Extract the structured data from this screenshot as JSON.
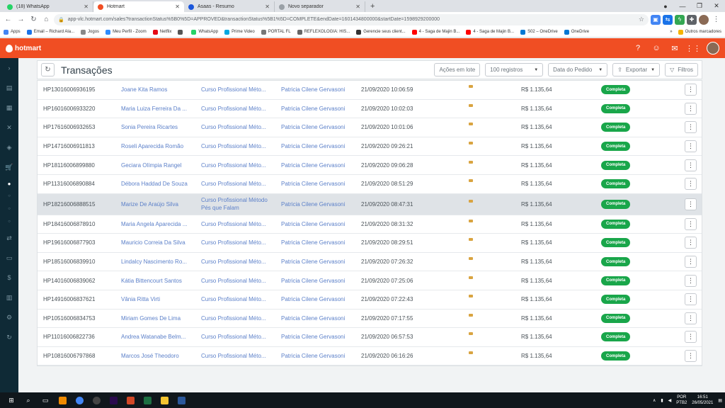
{
  "browser": {
    "tabs": [
      {
        "title": "(18) WhatsApp",
        "color": "#25d366",
        "active": false
      },
      {
        "title": "Hotmart",
        "color": "#f04e23",
        "active": true
      },
      {
        "title": "Asaas - Resumo",
        "color": "#1a56db",
        "active": false
      },
      {
        "title": "Novo separador",
        "color": "#9aa0a6",
        "active": false
      }
    ],
    "new_tab": "+",
    "url": "app-vlc.hotmart.com/sales?transactionStatus%5B0%5D=APPROVED&transactionStatus%5B1%5D=COMPLETE&endDate=1601434800000&startDate=1598929200000",
    "bookmarks": [
      {
        "label": "Apps",
        "color": "#4285f4"
      },
      {
        "label": "Email – Richard Ala...",
        "color": "#1a73e8"
      },
      {
        "label": "Jogos",
        "color": "#888888"
      },
      {
        "label": "Meu Perfil - Zoom",
        "color": "#2d8cff"
      },
      {
        "label": "Netflix",
        "color": "#e50914"
      },
      {
        "label": "",
        "color": "#555555"
      },
      {
        "label": "WhatsApp",
        "color": "#25d366"
      },
      {
        "label": "Prime Video",
        "color": "#00a8e1"
      },
      {
        "label": "PORTAL FL",
        "color": "#777777"
      },
      {
        "label": "REFLEXOLOGIA: HIS...",
        "color": "#666666"
      },
      {
        "label": "Gerencie seus client...",
        "color": "#333333"
      },
      {
        "label": "4 - Saga de Majin B...",
        "color": "#ff0000"
      },
      {
        "label": "4 - Saga de Majin B...",
        "color": "#ff0000"
      },
      {
        "label": "S02 – OneDrive",
        "color": "#0078d4"
      },
      {
        "label": "OneDrive",
        "color": "#0078d4"
      }
    ],
    "bookmarks_more": "»",
    "other_bookmarks": "Outros marcadores"
  },
  "header": {
    "logo": "hotmart",
    "accent": "#f04e23"
  },
  "toolbar": {
    "title": "Transações",
    "batch_actions": "Ações em lote",
    "page_size": "100 registros",
    "sort": "Data do Pedido",
    "export": "Exportar",
    "filters": "Filtros"
  },
  "transactions": [
    {
      "code": "HP13016006936195",
      "buyer": "Joane Kita Ramos",
      "product": "Curso Profissional Méto...",
      "affiliate": "Patricia Cilene Gervasoni",
      "date": "21/09/2020 10:06:59",
      "card": "mastercard",
      "value": "R$ 1.135,64",
      "status": "Completa"
    },
    {
      "code": "HP16016006933220",
      "buyer": "Maria Luiza Ferreira Da ...",
      "product": "Curso Profissional Méto...",
      "affiliate": "Patricia Cilene Gervasoni",
      "date": "21/09/2020 10:02:03",
      "card": "mastercard",
      "value": "R$ 1.135,64",
      "status": "Completa"
    },
    {
      "code": "HP17616006932653",
      "buyer": "Sonia Pereira Ricartes",
      "product": "Curso Profissional Méto...",
      "affiliate": "Patricia Cilene Gervasoni",
      "date": "21/09/2020 10:01:06",
      "card": "visa",
      "value": "R$ 1.135,64",
      "status": "Completa"
    },
    {
      "code": "HP14716006911813",
      "buyer": "Roseli Aparecida Romão",
      "product": "Curso Profissional Méto...",
      "affiliate": "Patricia Cilene Gervasoni",
      "date": "21/09/2020 09:26:21",
      "card": "visa",
      "value": "R$ 1.135,64",
      "status": "Completa"
    },
    {
      "code": "HP18116006899880",
      "buyer": "Geciara Olímpia Rangel",
      "product": "Curso Profissional Méto...",
      "affiliate": "Patricia Cilene Gervasoni",
      "date": "21/09/2020 09:06:28",
      "card": "mastercard",
      "value": "R$ 1.135,64",
      "status": "Completa"
    },
    {
      "code": "HP11316006890884",
      "buyer": "Débora Haddad De Souza",
      "product": "Curso Profissional Méto...",
      "affiliate": "Patricia Cilene Gervasoni",
      "date": "21/09/2020 08:51:29",
      "card": "visa",
      "value": "R$ 1.135,64",
      "status": "Completa"
    },
    {
      "code": "HP18216006888515",
      "buyer": "Marize De Araújo Silva",
      "product": "Curso Profissional Método Pés que Falam",
      "affiliate": "Patricia Cilene Gervasoni",
      "date": "21/09/2020 08:47:31",
      "card": "visa",
      "value": "R$ 1.135,64",
      "status": "Completa"
    },
    {
      "code": "HP18416006878910",
      "buyer": "Maria Angela Aparecida ...",
      "product": "Curso Profissional Méto...",
      "affiliate": "Patricia Cilene Gervasoni",
      "date": "21/09/2020 08:31:32",
      "card": "elo",
      "value": "R$ 1.135,64",
      "status": "Completa"
    },
    {
      "code": "HP19616006877903",
      "buyer": "Mauricio Correia Da Silva",
      "product": "Curso Profissional Méto...",
      "affiliate": "Patricia Cilene Gervasoni",
      "date": "21/09/2020 08:29:51",
      "card": "visa",
      "value": "R$ 1.135,64",
      "status": "Completa"
    },
    {
      "code": "HP18516006839910",
      "buyer": "Lindalcy Nascimento Ro...",
      "product": "Curso Profissional Méto...",
      "affiliate": "Patricia Cilene Gervasoni",
      "date": "21/09/2020 07:26:32",
      "card": "visa",
      "value": "R$ 1.135,64",
      "status": "Completa"
    },
    {
      "code": "HP14016006839062",
      "buyer": "Kátia Bittencourt Santos",
      "product": "Curso Profissional Méto...",
      "affiliate": "Patricia Cilene Gervasoni",
      "date": "21/09/2020 07:25:06",
      "card": "visa",
      "value": "R$ 1.135,64",
      "status": "Completa"
    },
    {
      "code": "HP14916006837621",
      "buyer": "Vânia Ritta Virti",
      "product": "Curso Profissional Méto...",
      "affiliate": "Patricia Cilene Gervasoni",
      "date": "21/09/2020 07:22:43",
      "card": "elo",
      "value": "R$ 1.135,64",
      "status": "Completa"
    },
    {
      "code": "HP10516006834753",
      "buyer": "Miriam Gomes De Lima",
      "product": "Curso Profissional Méto...",
      "affiliate": "Patricia Cilene Gervasoni",
      "date": "21/09/2020 07:17:55",
      "card": "mastercard",
      "value": "R$ 1.135,64",
      "status": "Completa"
    },
    {
      "code": "HP11016006822736",
      "buyer": "Andrea Watanabe Belm...",
      "product": "Curso Profissional Méto...",
      "affiliate": "Patricia Cilene Gervasoni",
      "date": "21/09/2020 06:57:53",
      "card": "visa",
      "value": "R$ 1.135,64",
      "status": "Completa"
    },
    {
      "code": "HP10816006797868",
      "buyer": "Marcos José Theodoro",
      "product": "Curso Profissional Méto...",
      "affiliate": "Patricia Cilene Gervasoni",
      "date": "21/09/2020 06:16:26",
      "card": "visa",
      "value": "R$ 1.135,64",
      "status": "Completa"
    }
  ],
  "taskbar": {
    "lang": "POR",
    "lang2": "PTB2",
    "time": "16:51",
    "date": "26/05/2021"
  }
}
